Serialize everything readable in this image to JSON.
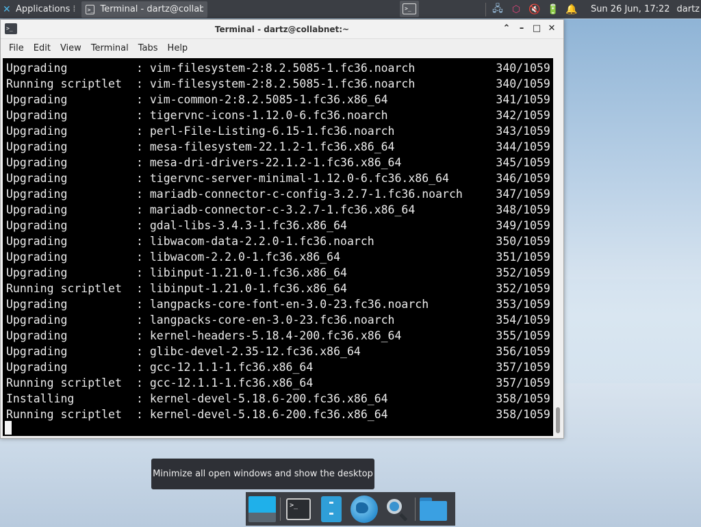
{
  "top_panel": {
    "applications_label": "Applications",
    "task_title": "Terminal - dartz@collabne...",
    "clock": "Sun 26 Jun, 17:22",
    "user": "dartz"
  },
  "window": {
    "title": "Terminal - dartz@collabnet:~",
    "menu": [
      "File",
      "Edit",
      "View",
      "Terminal",
      "Tabs",
      "Help"
    ]
  },
  "terminal": {
    "lines": [
      {
        "action": "Upgrading",
        "package": "vim-filesystem-2:8.2.5085-1.fc36.noarch",
        "count": "340/1059"
      },
      {
        "action": "Running scriptlet",
        "package": "vim-filesystem-2:8.2.5085-1.fc36.noarch",
        "count": "340/1059"
      },
      {
        "action": "Upgrading",
        "package": "vim-common-2:8.2.5085-1.fc36.x86_64",
        "count": "341/1059"
      },
      {
        "action": "Upgrading",
        "package": "tigervnc-icons-1.12.0-6.fc36.noarch",
        "count": "342/1059"
      },
      {
        "action": "Upgrading",
        "package": "perl-File-Listing-6.15-1.fc36.noarch",
        "count": "343/1059"
      },
      {
        "action": "Upgrading",
        "package": "mesa-filesystem-22.1.2-1.fc36.x86_64",
        "count": "344/1059"
      },
      {
        "action": "Upgrading",
        "package": "mesa-dri-drivers-22.1.2-1.fc36.x86_64",
        "count": "345/1059"
      },
      {
        "action": "Upgrading",
        "package": "tigervnc-server-minimal-1.12.0-6.fc36.x86_64",
        "count": "346/1059"
      },
      {
        "action": "Upgrading",
        "package": "mariadb-connector-c-config-3.2.7-1.fc36.noarch",
        "count": "347/1059"
      },
      {
        "action": "Upgrading",
        "package": "mariadb-connector-c-3.2.7-1.fc36.x86_64",
        "count": "348/1059"
      },
      {
        "action": "Upgrading",
        "package": "gdal-libs-3.4.3-1.fc36.x86_64",
        "count": "349/1059"
      },
      {
        "action": "Upgrading",
        "package": "libwacom-data-2.2.0-1.fc36.noarch",
        "count": "350/1059"
      },
      {
        "action": "Upgrading",
        "package": "libwacom-2.2.0-1.fc36.x86_64",
        "count": "351/1059"
      },
      {
        "action": "Upgrading",
        "package": "libinput-1.21.0-1.fc36.x86_64",
        "count": "352/1059"
      },
      {
        "action": "Running scriptlet",
        "package": "libinput-1.21.0-1.fc36.x86_64",
        "count": "352/1059"
      },
      {
        "action": "Upgrading",
        "package": "langpacks-core-font-en-3.0-23.fc36.noarch",
        "count": "353/1059"
      },
      {
        "action": "Upgrading",
        "package": "langpacks-core-en-3.0-23.fc36.noarch",
        "count": "354/1059"
      },
      {
        "action": "Upgrading",
        "package": "kernel-headers-5.18.4-200.fc36.x86_64",
        "count": "355/1059"
      },
      {
        "action": "Upgrading",
        "package": "glibc-devel-2.35-12.fc36.x86_64",
        "count": "356/1059"
      },
      {
        "action": "Upgrading",
        "package": "gcc-12.1.1-1.fc36.x86_64",
        "count": "357/1059"
      },
      {
        "action": "Running scriptlet",
        "package": "gcc-12.1.1-1.fc36.x86_64",
        "count": "357/1059"
      },
      {
        "action": "Installing",
        "package": "kernel-devel-5.18.6-200.fc36.x86_64",
        "count": "358/1059"
      },
      {
        "action": "Running scriptlet",
        "package": "kernel-devel-5.18.6-200.fc36.x86_64",
        "count": "358/1059"
      }
    ]
  },
  "tooltip": {
    "text": "Minimize all open windows and show the desktop"
  },
  "dock": {
    "items": [
      "show-desktop",
      "terminal",
      "file-manager",
      "web-browser",
      "app-finder",
      "home-folder"
    ]
  }
}
